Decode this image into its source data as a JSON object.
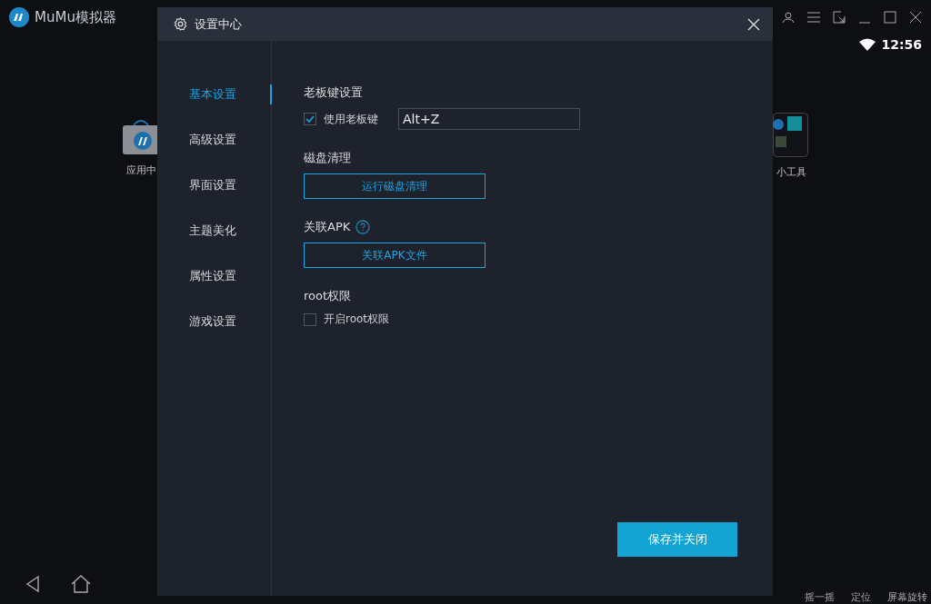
{
  "app": {
    "title": "MuMu模拟器"
  },
  "status_bar": {
    "time": "12:56"
  },
  "desktop_apps": [
    {
      "label": "应用中"
    },
    {
      "label": "小工具"
    }
  ],
  "bottom_bar": {
    "labels": [
      "摇一摇",
      "定位",
      "屏幕旋转"
    ]
  },
  "dialog": {
    "title": "设置中心",
    "nav": [
      {
        "label": "基本设置",
        "selected": true
      },
      {
        "label": "高级设置",
        "selected": false
      },
      {
        "label": "界面设置",
        "selected": false
      },
      {
        "label": "主题美化",
        "selected": false
      },
      {
        "label": "属性设置",
        "selected": false
      },
      {
        "label": "游戏设置",
        "selected": false
      }
    ],
    "sections": [
      {
        "kind": "checkbox",
        "heading": "老板键设置",
        "label": "使用老板键",
        "checked": true,
        "value": "Alt+Z"
      },
      {
        "kind": "button",
        "heading": "磁盘清理",
        "button": "运行磁盘清理"
      },
      {
        "kind": "button",
        "heading": "关联APK",
        "help": true,
        "button": "关联APK文件"
      },
      {
        "kind": "checkbox",
        "heading": "root权限",
        "label": "开启root权限",
        "checked": false
      }
    ],
    "save_button": "保存并关闭"
  }
}
